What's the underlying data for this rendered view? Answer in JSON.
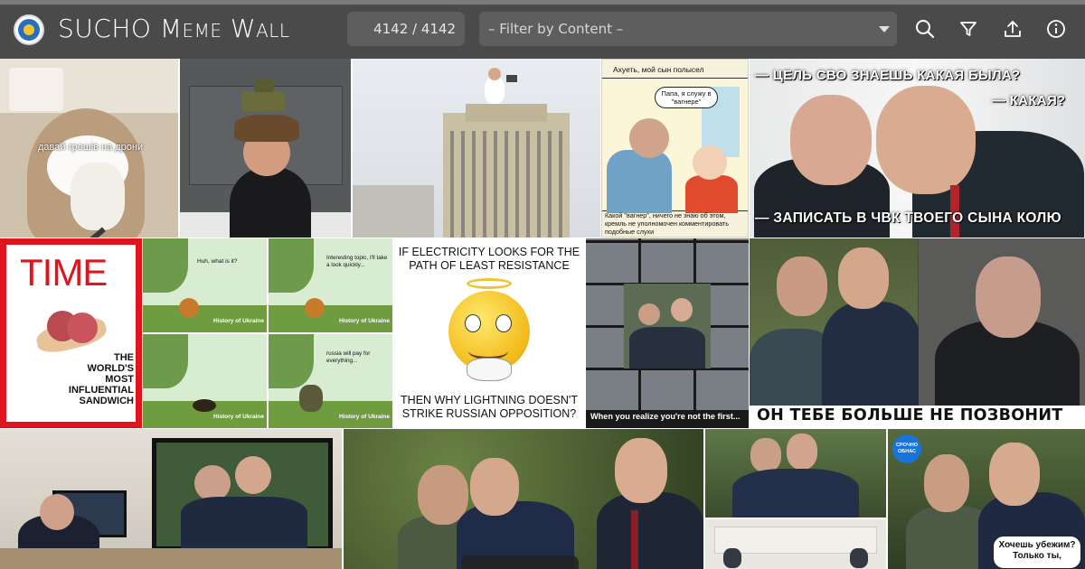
{
  "app": {
    "title": "SUCHO Meme Wall",
    "counter": "4142 / 4142",
    "filter_placeholder": "– Filter by Content –"
  },
  "toolbar_icons": [
    "search-icon",
    "filter-icon",
    "upload-icon",
    "info-icon"
  ],
  "colors": {
    "topbar": "#4a4a4a",
    "field": "#5e5e5e",
    "time_red": "#e0141e"
  },
  "tiles": {
    "cat": {
      "caption": "давай грошів на дрони"
    },
    "comic": {
      "top": "Ахуеть, мой сын полысел",
      "bubble": "Папа, я служу в \"вагнере\"",
      "bottom": "Какой \"вагнер\", ничего не знаю об этом, кремль не уполномочен комментировать подобные слухи"
    },
    "putin_peskov": {
      "line1": "— ЦЕЛЬ СВО ЗНАЕШЬ КАКАЯ БЫЛА?",
      "line2": "— КАКАЯ?",
      "line3": "— ЗАПИСАТЬ В ЧВК ТВОЕГО СЫНА КОЛЮ"
    },
    "time": {
      "logo": "TIME",
      "words": [
        "THE",
        "WORLD'S",
        "MOST",
        "INFLUENTIAL",
        "SANDWICH"
      ]
    },
    "pooh": {
      "panels": [
        {
          "bubble": "Huh, what is it?",
          "label": "History of Ukraine"
        },
        {
          "bubble": "Interesting topic, I'll take a look quickly...",
          "label": "History of Ukraine"
        },
        {
          "bubble": "",
          "label": "History of Ukraine"
        },
        {
          "bubble": "russia will pay for everything...",
          "label": "History of Ukraine"
        }
      ]
    },
    "electricity": {
      "top": "IF ELECTRICITY LOOKS FOR THE PATH OF LEAST RESISTANCE",
      "bottom": "THEN WHY LIGHTNING DOESN'T STRIKE RUSSIAN OPPOSITION?"
    },
    "collage": {
      "caption": "When you realize you're not the first..."
    },
    "call": {
      "caption": "ОН ТЕБЕ БОЛЬШЕ НЕ ПОЗВОНИТ"
    },
    "news": {
      "badge_line1": "СРОЧНО",
      "badge_line2": "ОБНАС",
      "bubble": "Хочешь убежим? Только ты,"
    }
  }
}
